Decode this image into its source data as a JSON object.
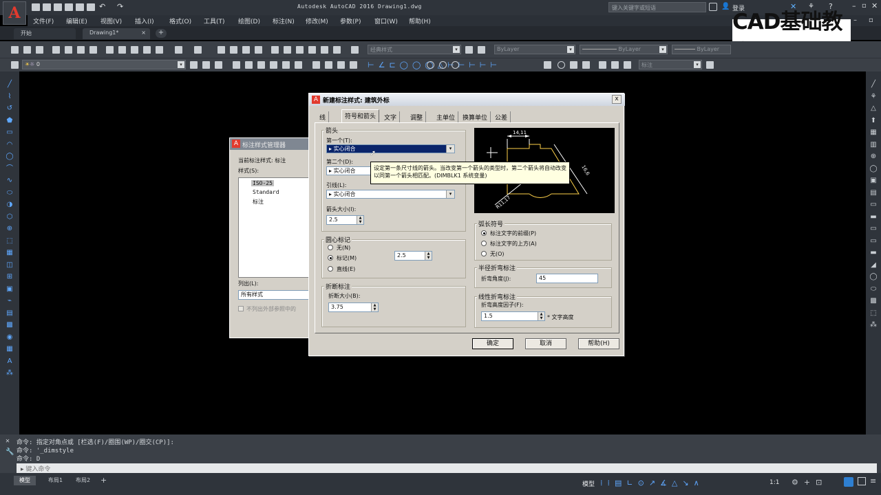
{
  "app": {
    "title": "Autodesk AutoCAD 2016    Drawing1.dwg",
    "logo_letter": "A",
    "search_placeholder": "键入关键字或短语",
    "login": "登录",
    "watermark": "CAD基础教学"
  },
  "menu": [
    "文件(F)",
    "编辑(E)",
    "视图(V)",
    "插入(I)",
    "格式(O)",
    "工具(T)",
    "绘图(D)",
    "标注(N)",
    "修改(M)",
    "参数(P)",
    "窗口(W)",
    "帮助(H)"
  ],
  "doc_tabs": [
    "开始",
    "Drawing1*"
  ],
  "toolbar": {
    "style_combo": "经典样式",
    "layer_combo": "ByLayer",
    "linetype_combo": "ByLayer",
    "lineweight_combo": "ByLayer",
    "layer_name": "0",
    "dim_style_combo": "标注"
  },
  "manager": {
    "title": "标注样式管理器",
    "current_label": "当前标注样式: 标注",
    "styles_label": "样式(S):",
    "styles": [
      "ISO-25",
      "Standard",
      "标注"
    ],
    "list_label": "列出(L):",
    "list_value": "所有样式",
    "checkbox_label": "不列出外部参照中的"
  },
  "dialog": {
    "title": "新建标注样式: 建筑外标",
    "close": "x",
    "tabs": [
      "线",
      "符号和箭头",
      "文字",
      "调整",
      "主单位",
      "换算单位",
      "公差"
    ],
    "arrows": {
      "group": "箭头",
      "first_label": "第一个(T):",
      "first_value": "实心闭合",
      "second_label": "第二个(D):",
      "second_value": "实心闭合",
      "leader_label": "引线(L):",
      "leader_value": "实心闭合",
      "size_label": "箭头大小(I):",
      "size_value": "2.5"
    },
    "center": {
      "group": "圆心标记",
      "none": "无(N)",
      "mark": "标记(M)",
      "line": "直线(E)",
      "size_value": "2.5"
    },
    "break": {
      "group": "折断标注",
      "size_label": "折断大小(B):",
      "size_value": "3.75"
    },
    "arc": {
      "group": "弧长符号",
      "prefix": "标注文字的前缀(P)",
      "above": "标注文字的上方(A)",
      "none": "无(O)"
    },
    "radius": {
      "group": "半径折弯标注",
      "angle_label": "折弯角度(J):",
      "angle_value": "45"
    },
    "linear": {
      "group": "线性折弯标注",
      "factor_label": "折弯高度因子(F):",
      "factor_value": "1.5",
      "suffix": "* 文字高度"
    },
    "preview": {
      "dim_top": "14,11",
      "dim_right": "16,6",
      "dim_left": "R11,17"
    },
    "tooltip": "设定第一条尺寸线的箭头。当改变第一个箭头的类型时，第二个箭头将自动改变以同第一个箭头相匹配。(DIMBLK1 系统变量)",
    "ok": "确定",
    "cancel": "取消",
    "help": "帮助(H)"
  },
  "command": {
    "line1": "命令: 指定对角点或 [栏选(F)/圈围(WP)/圈交(CP)]:",
    "line2": "命令: '_dimstyle",
    "line3": "命令: D",
    "input_placeholder": "键入命令"
  },
  "layout_tabs": [
    "模型",
    "布局1",
    "布局2"
  ],
  "status": {
    "model": "模型",
    "scale": "1:1"
  }
}
